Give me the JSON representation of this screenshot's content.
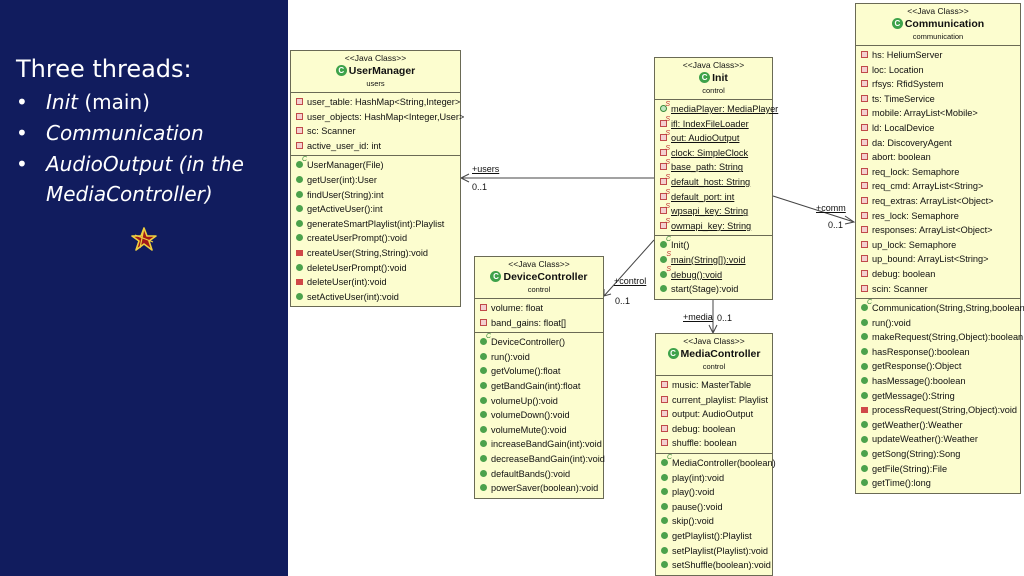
{
  "sidebar": {
    "title": "Three threads:",
    "bullets": [
      {
        "italic": "Init",
        "normal": " (main)"
      },
      {
        "italic": "Communication",
        "normal": ""
      },
      {
        "italic": "AudioOutput (in the",
        "normal": ""
      },
      {
        "italic": "MediaController)",
        "normal": ""
      }
    ],
    "bullet_char": "•",
    "logo": "star-icon"
  },
  "stereotype": "<<Java Class>>",
  "classes": {
    "usermanager": {
      "name": "UserManager",
      "package": "users",
      "fields": [
        {
          "vis": "private",
          "text": "user_table: HashMap<String,Integer>"
        },
        {
          "vis": "private",
          "text": "user_objects: HashMap<Integer,User>"
        },
        {
          "vis": "private",
          "text": "sc: Scanner"
        },
        {
          "vis": "private",
          "text": "active_user_id: int"
        }
      ],
      "methods": [
        {
          "vis": "ctor",
          "text": "UserManager(File)"
        },
        {
          "vis": "public",
          "text": "getUser(int):User"
        },
        {
          "vis": "public",
          "text": "findUser(String):int"
        },
        {
          "vis": "public",
          "text": "getActiveUser():int"
        },
        {
          "vis": "public",
          "text": "generateSmartPlaylist(int):Playlist"
        },
        {
          "vis": "public",
          "text": "createUserPrompt():void"
        },
        {
          "vis": "private",
          "text": "createUser(String,String):void"
        },
        {
          "vis": "public",
          "text": "deleteUserPrompt():void"
        },
        {
          "vis": "private",
          "text": "deleteUser(int):void"
        },
        {
          "vis": "public",
          "text": "setActiveUser(int):void"
        }
      ]
    },
    "init": {
      "name": "Init",
      "package": "control",
      "fields": [
        {
          "vis": "public-static",
          "text": "mediaPlayer: MediaPlayer"
        },
        {
          "vis": "private-static",
          "text": "ifl: IndexFileLoader"
        },
        {
          "vis": "private-static",
          "text": "out: AudioOutput"
        },
        {
          "vis": "private-static",
          "text": "clock: SimpleClock"
        },
        {
          "vis": "private-static",
          "text": "base_path: String"
        },
        {
          "vis": "private-static",
          "text": "default_host: String"
        },
        {
          "vis": "private-static",
          "text": "default_port: int"
        },
        {
          "vis": "private-static",
          "text": "wpsapi_key: String"
        },
        {
          "vis": "private-static",
          "text": "owmapi_key: String"
        }
      ],
      "methods": [
        {
          "vis": "ctor",
          "text": "Init()"
        },
        {
          "vis": "public-static",
          "text": "main(String[]):void"
        },
        {
          "vis": "public-static",
          "text": "debug():void"
        },
        {
          "vis": "public",
          "text": "start(Stage):void"
        }
      ]
    },
    "devicecontroller": {
      "name": "DeviceController",
      "package": "control",
      "fields": [
        {
          "vis": "private",
          "text": "volume: float"
        },
        {
          "vis": "private",
          "text": "band_gains: float[]"
        }
      ],
      "methods": [
        {
          "vis": "ctor",
          "text": "DeviceController()"
        },
        {
          "vis": "public",
          "text": "run():void"
        },
        {
          "vis": "public",
          "text": "getVolume():float"
        },
        {
          "vis": "public",
          "text": "getBandGain(int):float"
        },
        {
          "vis": "public",
          "text": "volumeUp():void"
        },
        {
          "vis": "public",
          "text": "volumeDown():void"
        },
        {
          "vis": "public",
          "text": "volumeMute():void"
        },
        {
          "vis": "public",
          "text": "increaseBandGain(int):void"
        },
        {
          "vis": "public",
          "text": "decreaseBandGain(int):void"
        },
        {
          "vis": "public",
          "text": "defaultBands():void"
        },
        {
          "vis": "public",
          "text": "powerSaver(boolean):void"
        }
      ]
    },
    "mediacontroller": {
      "name": "MediaController",
      "package": "control",
      "fields": [
        {
          "vis": "private",
          "text": "music: MasterTable"
        },
        {
          "vis": "private",
          "text": "current_playlist: Playlist"
        },
        {
          "vis": "private",
          "text": "output: AudioOutput"
        },
        {
          "vis": "private",
          "text": "debug: boolean"
        },
        {
          "vis": "private",
          "text": "shuffle: boolean"
        }
      ],
      "methods": [
        {
          "vis": "ctor",
          "text": "MediaController(boolean)"
        },
        {
          "vis": "public",
          "text": "play(int):void"
        },
        {
          "vis": "public",
          "text": "play():void"
        },
        {
          "vis": "public",
          "text": "pause():void"
        },
        {
          "vis": "public",
          "text": "skip():void"
        },
        {
          "vis": "public",
          "text": "getPlaylist():Playlist"
        },
        {
          "vis": "public",
          "text": "setPlaylist(Playlist):void"
        },
        {
          "vis": "public",
          "text": "setShuffle(boolean):void"
        }
      ]
    },
    "communication": {
      "name": "Communication",
      "package": "communication",
      "fields": [
        {
          "vis": "private",
          "text": "hs: HeliumServer"
        },
        {
          "vis": "private",
          "text": "loc: Location"
        },
        {
          "vis": "private",
          "text": "rfsys: RfidSystem"
        },
        {
          "vis": "private",
          "text": "ts: TimeService"
        },
        {
          "vis": "private",
          "text": "mobile: ArrayList<Mobile>"
        },
        {
          "vis": "private",
          "text": "ld: LocalDevice"
        },
        {
          "vis": "private",
          "text": "da: DiscoveryAgent"
        },
        {
          "vis": "private",
          "text": "abort: boolean"
        },
        {
          "vis": "private",
          "text": "req_lock: Semaphore"
        },
        {
          "vis": "private",
          "text": "req_cmd: ArrayList<String>"
        },
        {
          "vis": "private",
          "text": "req_extras: ArrayList<Object>"
        },
        {
          "vis": "private",
          "text": "res_lock: Semaphore"
        },
        {
          "vis": "private",
          "text": "responses: ArrayList<Object>"
        },
        {
          "vis": "private",
          "text": "up_lock: Semaphore"
        },
        {
          "vis": "private",
          "text": "up_bound: ArrayList<String>"
        },
        {
          "vis": "private",
          "text": "debug: boolean"
        },
        {
          "vis": "private",
          "text": "scin: Scanner"
        }
      ],
      "methods": [
        {
          "vis": "ctor",
          "text": "Communication(String,String,boolean)"
        },
        {
          "vis": "public",
          "text": "run():void"
        },
        {
          "vis": "public",
          "text": "makeRequest(String,Object):boolean"
        },
        {
          "vis": "public",
          "text": "hasResponse():boolean"
        },
        {
          "vis": "public",
          "text": "getResponse():Object"
        },
        {
          "vis": "public",
          "text": "hasMessage():boolean"
        },
        {
          "vis": "public",
          "text": "getMessage():String"
        },
        {
          "vis": "private",
          "text": "processRequest(String,Object):void"
        },
        {
          "vis": "public",
          "text": "getWeather():Weather"
        },
        {
          "vis": "public",
          "text": "updateWeather():Weather"
        },
        {
          "vis": "public",
          "text": "getSong(String):Song"
        },
        {
          "vis": "public",
          "text": "getFile(String):File"
        },
        {
          "vis": "public",
          "text": "getTime():long"
        }
      ]
    }
  },
  "associations": [
    {
      "from": "Init",
      "to": "UserManager",
      "role": "+users",
      "multiplicity": "0..1"
    },
    {
      "from": "Init",
      "to": "DeviceController",
      "role": "+control",
      "multiplicity": "0..1"
    },
    {
      "from": "Init",
      "to": "MediaController",
      "role": "+media",
      "multiplicity": "0..1"
    },
    {
      "from": "Init",
      "to": "Communication",
      "role": "+comm",
      "multiplicity": "0..1"
    }
  ],
  "colors": {
    "sidebar_bg": "#111c5e",
    "class_fill": "#fcfdcf",
    "public_icon": "#4ca24c",
    "private_icon": "#d04848"
  }
}
